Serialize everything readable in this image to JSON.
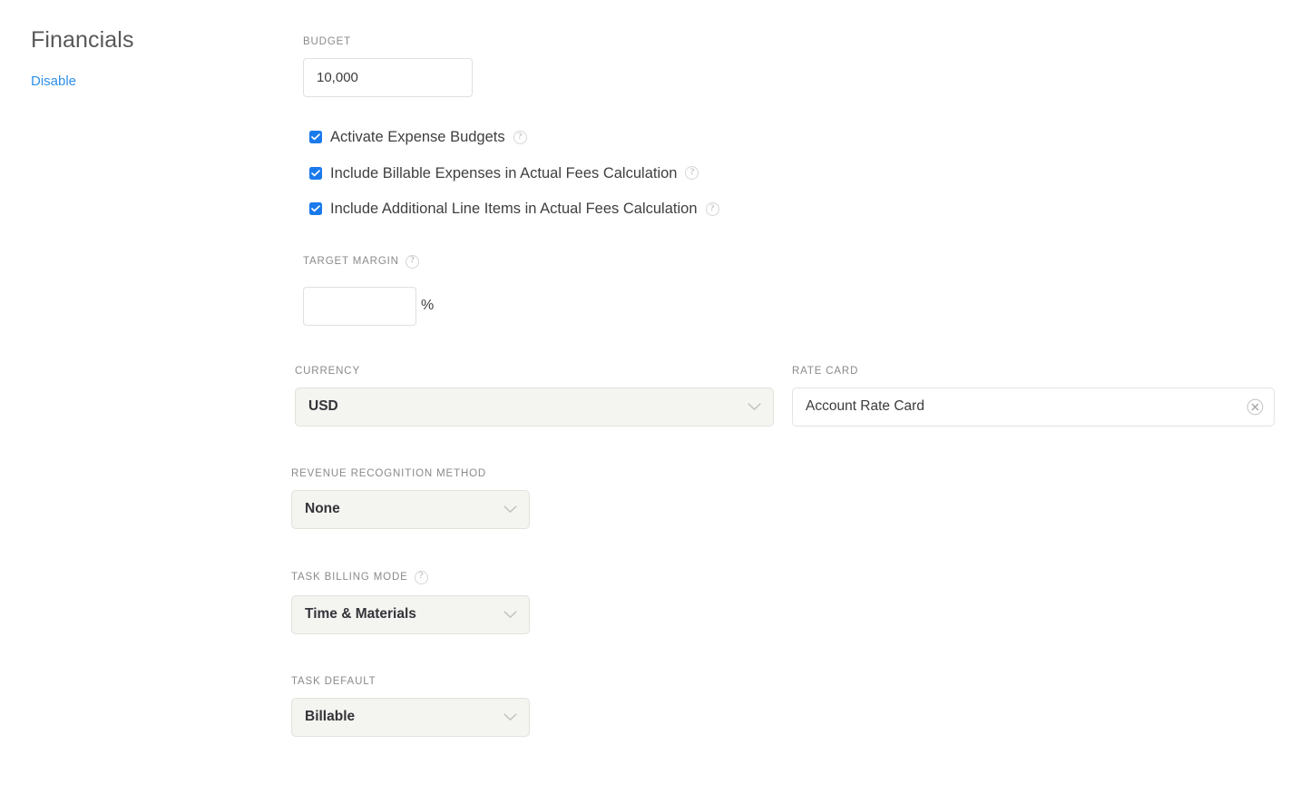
{
  "section": {
    "title": "Financials",
    "disable_label": "Disable"
  },
  "budget": {
    "label": "BUDGET",
    "value": "10,000",
    "placeholder": ""
  },
  "checkboxes": [
    {
      "label": "Activate Expense Budgets",
      "checked": true,
      "help": "?"
    },
    {
      "label": "Include Billable Expenses in Actual Fees Calculation",
      "checked": true,
      "help": "?"
    },
    {
      "label": "Include Additional Line Items in Actual Fees Calculation",
      "checked": true,
      "help": "?"
    }
  ],
  "target_margin": {
    "label": "TARGET MARGIN",
    "help": "?",
    "value": "",
    "placeholder": "",
    "suffix": "%"
  },
  "currency": {
    "label": "CURRENCY",
    "value": "USD"
  },
  "rate_card": {
    "label": "RATE CARD",
    "value": "Account Rate Card",
    "clear_icon": "clear-circle-icon"
  },
  "revenue_recognition": {
    "label": "REVENUE RECOGNITION METHOD",
    "value": "None"
  },
  "task_billing_mode": {
    "label": "TASK BILLING MODE",
    "help": "?",
    "value": "Time & Materials"
  },
  "task_default": {
    "label": "TASK DEFAULT",
    "value": "Billable"
  },
  "colors": {
    "link": "#2f8fe8",
    "checkbox": "#1a7aec",
    "select_bg": "#f4f4f0",
    "label": "#8a8a8a",
    "text": "#3c3c3c"
  }
}
